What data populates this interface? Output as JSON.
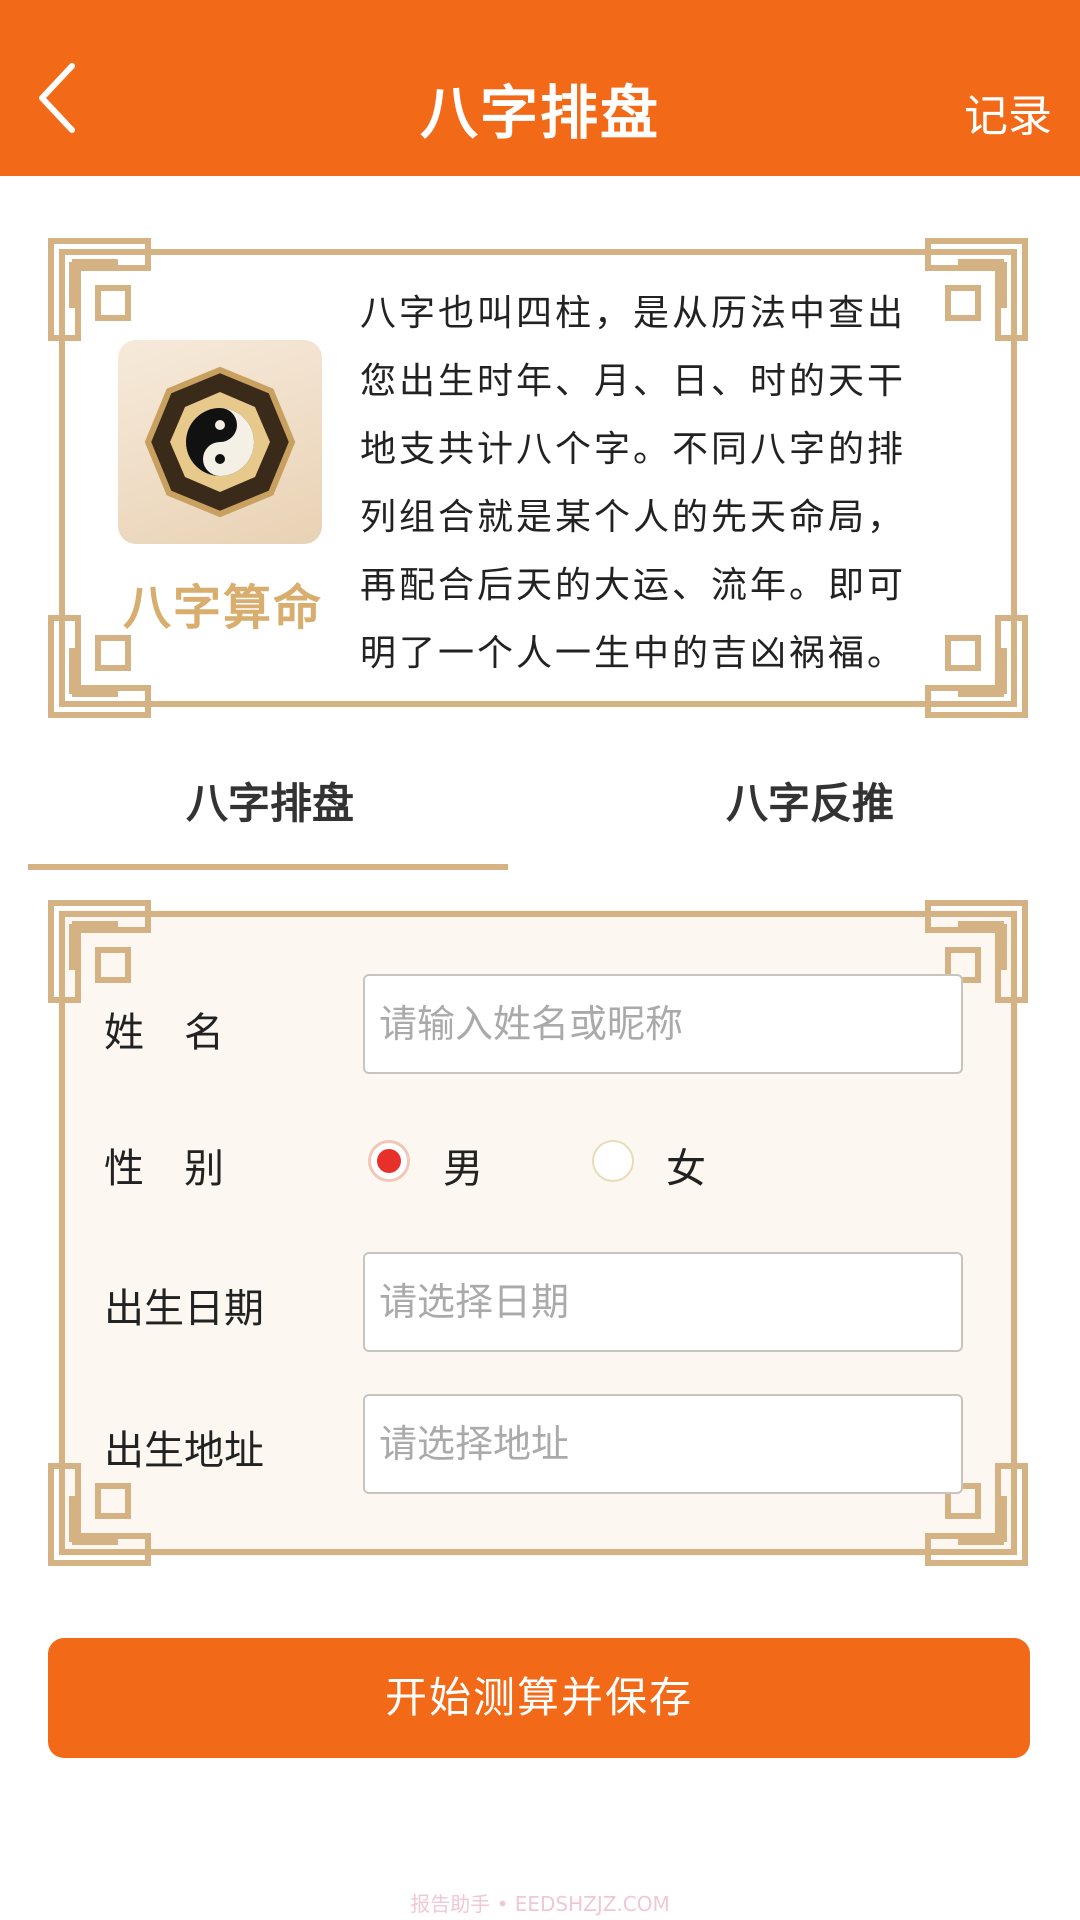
{
  "header": {
    "title": "八字排盘",
    "record_label": "记录"
  },
  "intro": {
    "logo_text": "八字算命",
    "lines": [
      "八字也叫四柱，是从历法中查出",
      "您出生时年、月、日、时的天干",
      "地支共计八个字。不同八字的排",
      "列组合就是某个人的先天命局，",
      "再配合后天的大运、流年。即可",
      "明了一个人一生中的吉凶祸福。"
    ]
  },
  "tabs": [
    {
      "label": "八字排盘",
      "active": true
    },
    {
      "label": "八字反推",
      "active": false
    }
  ],
  "form": {
    "name_label": "姓　名",
    "name_placeholder": "请输入姓名或昵称",
    "gender_label": "性　别",
    "gender_options": [
      "男",
      "女"
    ],
    "gender_selected": "男",
    "date_label": "出生日期",
    "date_placeholder": "请选择日期",
    "address_label": "出生地址",
    "address_placeholder": "请选择地址"
  },
  "submit_label": "开始测算并保存",
  "watermark": "报告助手 • EEDSHZJZ.COM",
  "colors": {
    "accent": "#f26a18",
    "gold": "#d4b283",
    "radio_selected": "#e8302a"
  }
}
